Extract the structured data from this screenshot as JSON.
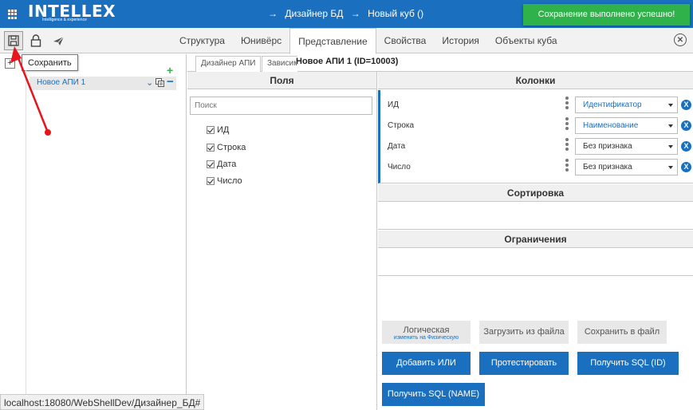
{
  "app": {
    "logo_text": "INTELLEX",
    "logo_subtitle": "Intelligence & experience",
    "breadcrumb": [
      {
        "arrow": "→",
        "label": "Дизайнер БД"
      },
      {
        "arrow": "→",
        "label": "Новый куб ()"
      }
    ],
    "toast": "Сохранение выполнено успешно!",
    "close_symbol": "✕"
  },
  "toolbar": {
    "tooltip": "Сохранить",
    "tabs": [
      "Структура",
      "Юнивёрс",
      "Представление",
      "Свойства",
      "История",
      "Объекты куба"
    ],
    "active_tab": "Представление"
  },
  "tree": {
    "add_symbol": "+",
    "add_green_symbol": "+",
    "item_label": "Новое АПИ 1",
    "item_chevron": "⌄",
    "item_minus": "−"
  },
  "status_url": "localhost:18080/WebShellDev/Дизайнер_БД#",
  "subtabs": {
    "tab1": "Дизайнер АПИ",
    "tab2": "Зависимости",
    "api_title": "Новое АПИ 1 (ID=10003)"
  },
  "fields": {
    "header": "Поля",
    "search_placeholder": "Поиск",
    "items": [
      "ИД",
      "Строка",
      "Дата",
      "Число"
    ]
  },
  "columns": {
    "header": "Колонки",
    "rows": [
      {
        "name": "ИД",
        "value": "Идентификатор",
        "remove": "X"
      },
      {
        "name": "Строка",
        "value": "Наименование",
        "remove": "X"
      },
      {
        "name": "Дата",
        "value": "Без признака",
        "remove": "X"
      },
      {
        "name": "Число",
        "value": "Без признака",
        "remove": "X"
      }
    ]
  },
  "sorting": {
    "header": "Сортировка"
  },
  "limits": {
    "header": "Ограничения"
  },
  "buttons": {
    "logical": "Логическая",
    "logical_sub": "изменить на Физическую",
    "load_file": "Загрузить из файла",
    "save_file": "Сохранить в файл",
    "add_or": "Добавить ИЛИ",
    "test": "Протестировать",
    "get_sql_id": "Получить SQL (ID)",
    "get_sql_name": "Получить SQL (NAME)"
  },
  "colors": {
    "brand": "#1a6fbf",
    "toast": "#2fb24a",
    "annotation": "#e8141b"
  }
}
